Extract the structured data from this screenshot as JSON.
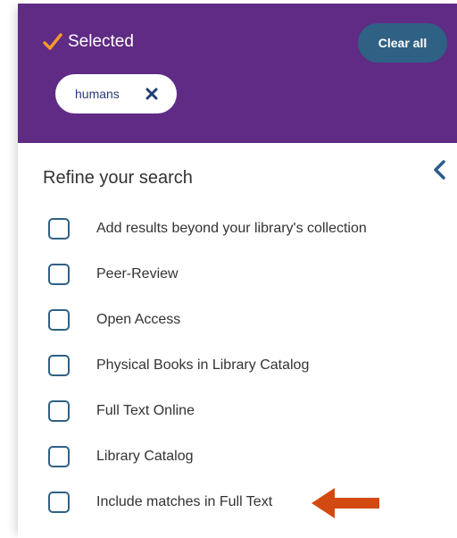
{
  "selected": {
    "title": "Selected",
    "clear_all_label": "Clear all",
    "chips": [
      {
        "label": "humans"
      }
    ]
  },
  "refine": {
    "title": "Refine your search",
    "facets": [
      {
        "label": "Add results beyond your library's collection",
        "checked": false
      },
      {
        "label": "Peer-Review",
        "checked": false
      },
      {
        "label": "Open Access",
        "checked": false
      },
      {
        "label": "Physical Books in Library Catalog",
        "checked": false
      },
      {
        "label": "Full Text Online",
        "checked": false
      },
      {
        "label": "Library Catalog",
        "checked": false
      },
      {
        "label": "Include matches in Full Text",
        "checked": false
      }
    ]
  },
  "icons": {
    "check": "checkmark-icon",
    "chip_remove": "close-icon",
    "collapse": "chevron-left-icon",
    "annotation": "arrow-left-icon"
  },
  "colors": {
    "selected_bg": "#5f2b84",
    "clear_all_bg": "#2f6184",
    "check": "#f39a2b",
    "chip_x": "#1f3f73",
    "checkbox_border": "#2f6184",
    "collapse_icon": "#2a5a8a",
    "annotation_arrow": "#d24a11"
  }
}
